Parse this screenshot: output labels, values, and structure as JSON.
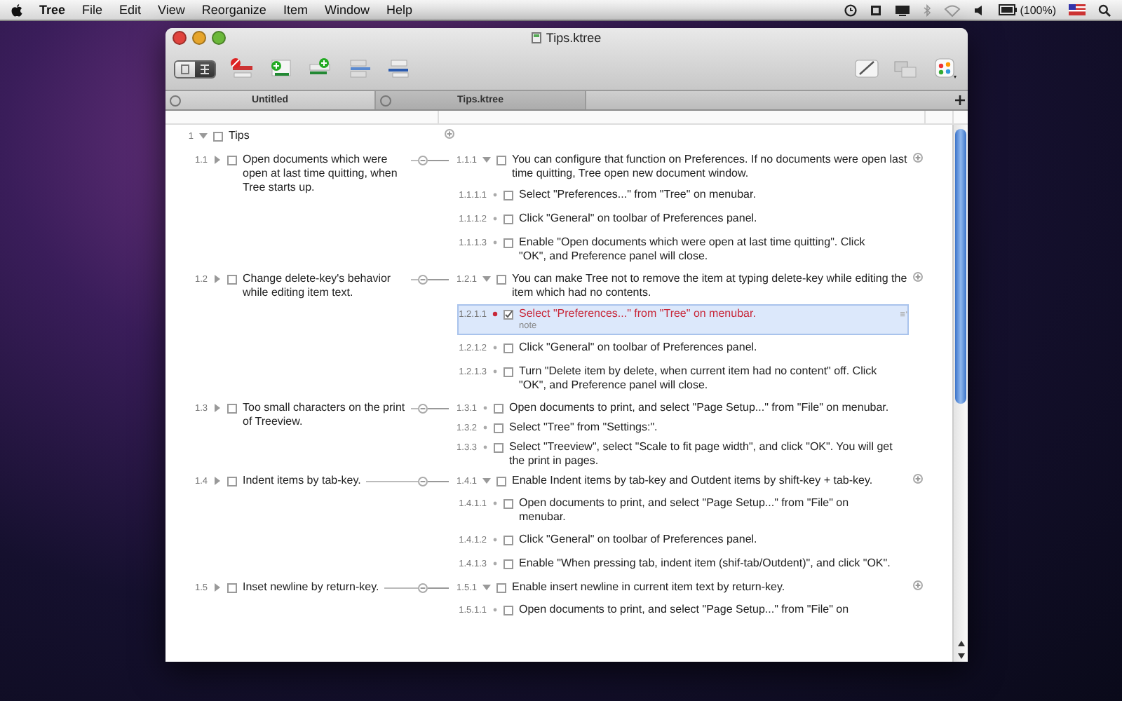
{
  "menubar": {
    "app": "Tree",
    "items": [
      "File",
      "Edit",
      "View",
      "Reorganize",
      "Item",
      "Window",
      "Help"
    ],
    "battery": "(100%)"
  },
  "window": {
    "title": "Tips.ktree"
  },
  "toolbar": {
    "view_modes": [
      {
        "kind": "list",
        "selected": false
      },
      {
        "kind": "tree",
        "selected": true
      }
    ]
  },
  "tabs": [
    {
      "label": "Untitled",
      "selected": false
    },
    {
      "label": "Tips.ktree",
      "selected": true
    }
  ],
  "outline": {
    "number": "1",
    "title": "Tips",
    "expanded": true,
    "checked": false,
    "sections": [
      {
        "number": "1.1",
        "text": "Open documents which were open at last time quitting, when Tree starts up.",
        "checked": false,
        "children": [
          {
            "number": "1.1.1",
            "text": "You can configure that function on Preferences. If no documents were open last time quitting, Tree open new document window.",
            "expanded": true,
            "checked": false,
            "children": [
              {
                "number": "1.1.1.1",
                "text": "Select \"Preferences...\" from \"Tree\" on menubar.",
                "checked": false,
                "selected": false
              },
              {
                "number": "1.1.1.2",
                "text": "Click \"General\" on toolbar of Preferences panel.",
                "checked": false,
                "selected": false
              },
              {
                "number": "1.1.1.3",
                "text": "Enable \"Open documents which were open at last time quitting\". Click \"OK\", and Preference panel will close.",
                "checked": false,
                "selected": false
              }
            ]
          }
        ]
      },
      {
        "number": "1.2",
        "text": "Change delete-key's behavior while editing item text.",
        "checked": false,
        "children": [
          {
            "number": "1.2.1",
            "text": "You can make Tree not to remove the item at typing delete-key while editing the item which had no contents.",
            "expanded": true,
            "checked": false,
            "children": [
              {
                "number": "1.2.1.1",
                "text": "Select \"Preferences...\" from \"Tree\" on menubar.",
                "checked": true,
                "selected": true,
                "color": "#c8283a",
                "note": "note"
              },
              {
                "number": "1.2.1.2",
                "text": "Click \"General\" on toolbar of Preferences panel.",
                "checked": false,
                "selected": false
              },
              {
                "number": "1.2.1.3",
                "text": "Turn \"Delete item by delete, when current item had no content\" off. Click \"OK\", and Preference panel will close.",
                "checked": false,
                "selected": false
              }
            ]
          }
        ]
      },
      {
        "number": "1.3",
        "text": "Too small characters on the print of Treeview.",
        "checked": false,
        "children": [
          {
            "number": "1.3.1",
            "text": "Open documents to print, and select \"Page Setup...\" from \"File\" on menubar.",
            "checked": false
          },
          {
            "number": "1.3.2",
            "text": "Select \"Tree\" from \"Settings:\".",
            "checked": false
          },
          {
            "number": "1.3.3",
            "text": "Select \"Treeview\", select \"Scale to fit page width\", and click \"OK\". You will get the print in pages.",
            "checked": false
          }
        ]
      },
      {
        "number": "1.4",
        "text": "Indent items by tab-key.",
        "checked": false,
        "children": [
          {
            "number": "1.4.1",
            "text": "Enable Indent items by tab-key and Outdent items by shift-key + tab-key.",
            "expanded": true,
            "checked": false,
            "children": [
              {
                "number": "1.4.1.1",
                "text": "Open documents to print, and select \"Page Setup...\" from \"File\" on menubar.",
                "checked": false,
                "selected": false
              },
              {
                "number": "1.4.1.2",
                "text": "Click \"General\" on toolbar of Preferences panel.",
                "checked": false,
                "selected": false
              },
              {
                "number": "1.4.1.3",
                "text": "Enable \"When pressing tab, indent item (shif-tab/Outdent)\", and click \"OK\".",
                "checked": false,
                "selected": false
              }
            ]
          }
        ]
      },
      {
        "number": "1.5",
        "text": "Inset newline by return-key.",
        "checked": false,
        "children": [
          {
            "number": "1.5.1",
            "text": "Enable insert newline in current item text by return-key.",
            "expanded": true,
            "checked": false,
            "children": [
              {
                "number": "1.5.1.1",
                "text": "Open documents to print, and select \"Page Setup...\" from \"File\" on",
                "checked": false,
                "selected": false
              }
            ]
          }
        ]
      }
    ]
  }
}
